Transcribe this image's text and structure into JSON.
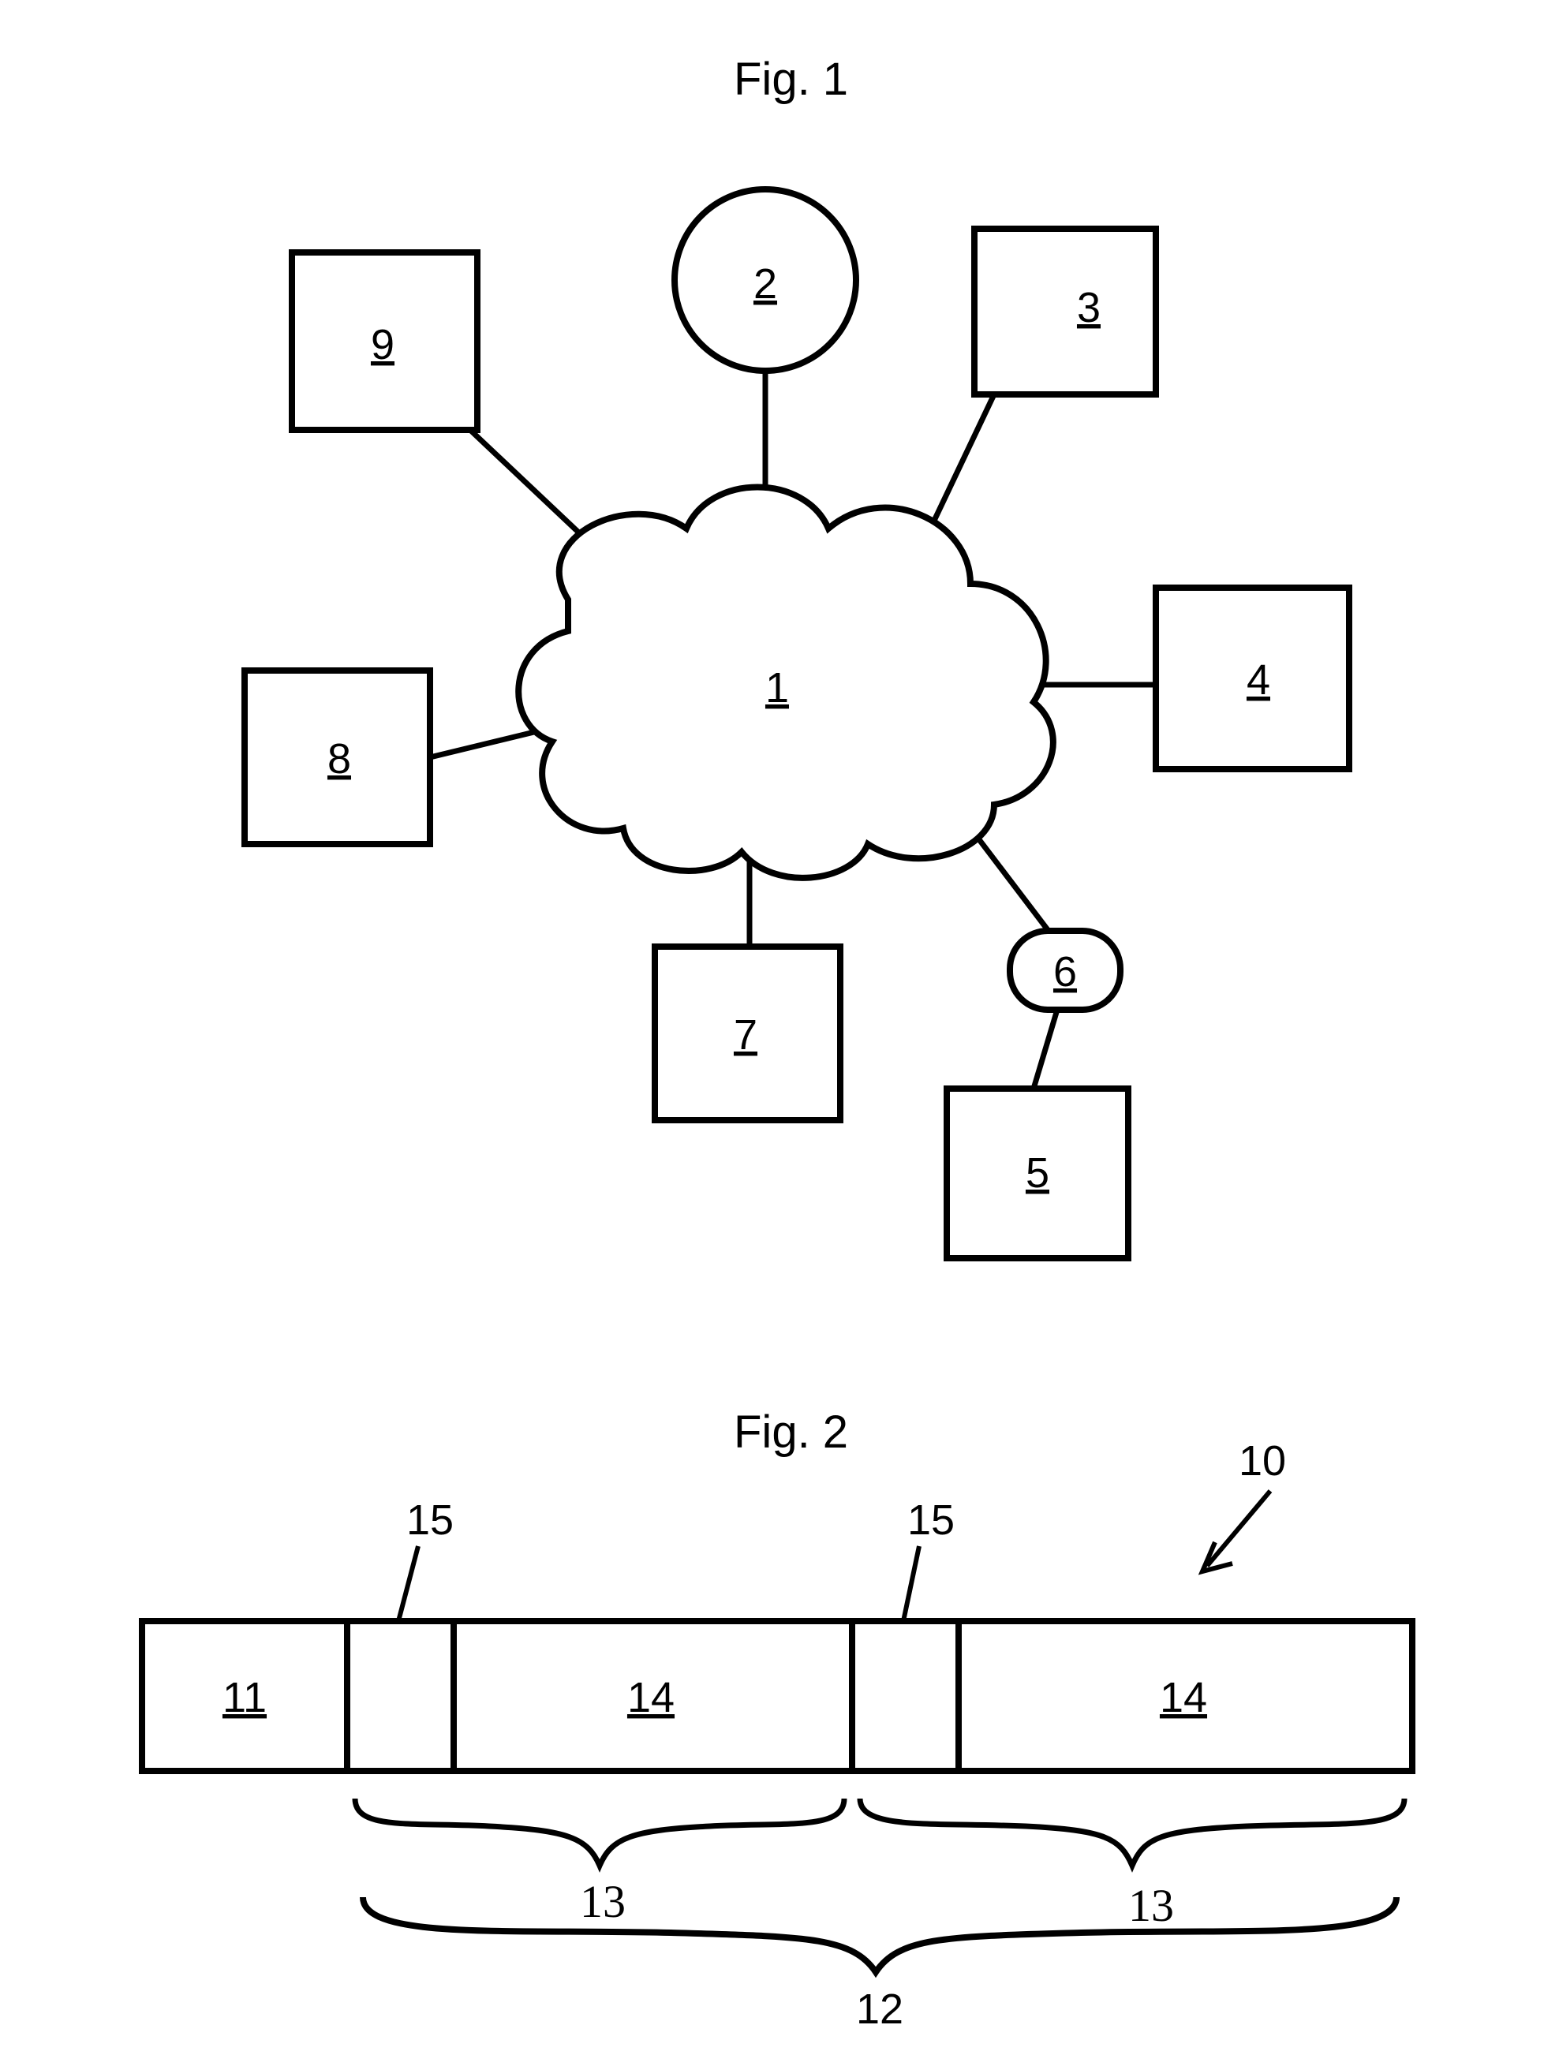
{
  "fig1": {
    "caption": "Fig. 1",
    "cloud": "1",
    "node2": "2",
    "node3": "3",
    "node4": "4",
    "node5": "5",
    "node6": "6",
    "node7": "7",
    "node8": "8",
    "node9": "9"
  },
  "fig2": {
    "caption": "Fig. 2",
    "ref10": "10",
    "cell11": "11",
    "group12": "12",
    "group13a": "13",
    "group13b": "13",
    "cell14a": "14",
    "cell14b": "14",
    "ref15a": "15",
    "ref15b": "15"
  }
}
